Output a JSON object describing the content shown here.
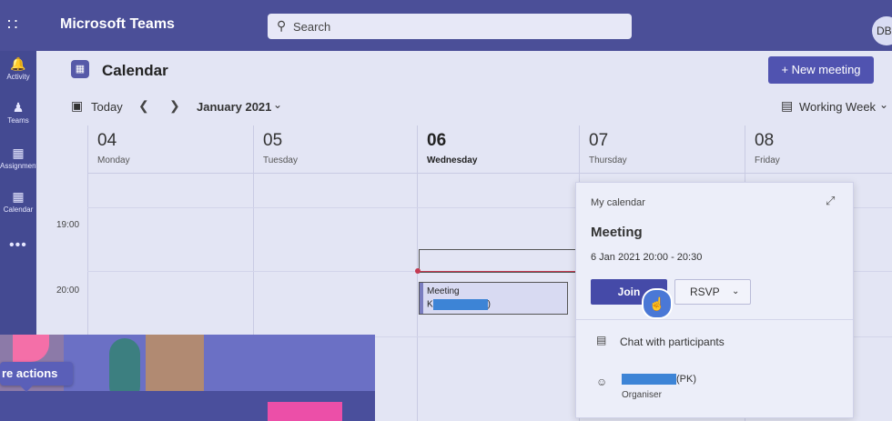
{
  "app": {
    "title": "Microsoft Teams",
    "search_placeholder": "Search",
    "avatar_initials": "DB"
  },
  "rail": {
    "items": [
      {
        "label": "Activity",
        "icon": "bell-icon"
      },
      {
        "label": "Teams",
        "icon": "teams-icon"
      },
      {
        "label": "Assignments",
        "icon": "backpack-icon"
      },
      {
        "label": "Calendar",
        "icon": "calendar-icon"
      }
    ],
    "more": "•••"
  },
  "calendar": {
    "title": "Calendar",
    "new_meeting": "+ New meeting",
    "today": "Today",
    "month": "January 2021",
    "view": "Working Week",
    "days": [
      {
        "num": "04",
        "name": "Monday"
      },
      {
        "num": "05",
        "name": "Tuesday"
      },
      {
        "num": "06",
        "name": "Wednesday"
      },
      {
        "num": "07",
        "name": "Thursday"
      },
      {
        "num": "08",
        "name": "Friday"
      }
    ],
    "times": [
      "19:00",
      "20:00"
    ],
    "event": {
      "title": "Meeting",
      "organiser_prefix": "K",
      "organiser_suffix": ")"
    }
  },
  "popup": {
    "calendar_name": "My calendar",
    "title": "Meeting",
    "time": "6 Jan 2021 20:00 - 20:30",
    "join": "Join",
    "rsvp": "RSVP",
    "chat": "Chat with participants",
    "organiser_suffix": "(PK)",
    "organiser_role": "Organiser"
  },
  "overlay": {
    "button": "re actions"
  },
  "colors": {
    "topbar": "#4b4f98",
    "rail": "#444a92",
    "accent": "#5053b0",
    "now_line": "#c43a52"
  }
}
